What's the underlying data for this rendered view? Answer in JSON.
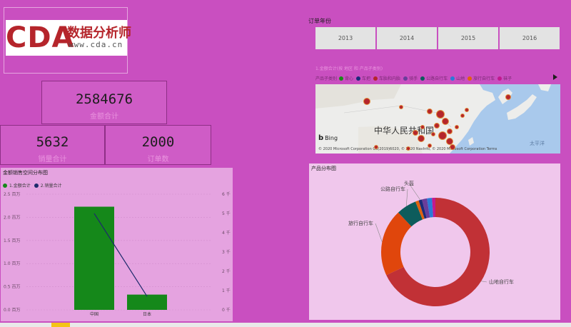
{
  "logo": {
    "brand": "CDA",
    "cn_text": "数据分析师",
    "url_text": "www.cda.cn"
  },
  "kpis": {
    "amount": {
      "value": "2584676",
      "label": "金额合计"
    },
    "quantity": {
      "value": "5632",
      "label": "销量合计"
    },
    "orders": {
      "value": "2000",
      "label": "订单数"
    }
  },
  "slicer": {
    "title": "订单年份",
    "years": [
      "2013",
      "2014",
      "2015",
      "2016"
    ]
  },
  "map": {
    "title": "1.金额合计(按 地区 和 产品子类别)",
    "legend_title": "产品子类别",
    "legend": [
      {
        "name": "背心",
        "color": "#1a8a1a"
      },
      {
        "name": "车把",
        "color": "#1c2b7a"
      },
      {
        "name": "车胎和内胎",
        "color": "#b5252b"
      },
      {
        "name": "骑手",
        "color": "#6a3d9a"
      },
      {
        "name": "公路自行车",
        "color": "#0d5c5c"
      },
      {
        "name": "山地",
        "color": "#2b7bd6"
      },
      {
        "name": "旅行自行车",
        "color": "#e0620e"
      },
      {
        "name": "袜子",
        "color": "#c2198f"
      }
    ],
    "country_label": "中华人民共和国",
    "pacific_label": "太平洋",
    "bing": "Bing",
    "copyright": "© 2020 Microsoft Corporation  GS(2019)6020, © 2020 NavInfo, © 2020 Microsoft Corporation  Terms"
  },
  "bar_panel": {
    "title": "金额销售空间分布图",
    "legend": [
      "1.金额合计",
      "2.销量合计"
    ]
  },
  "pie_panel": {
    "title": "产品分布图"
  },
  "chart_data": [
    {
      "type": "bar",
      "title": "金额销售空间分布图",
      "categories": [
        "中国",
        "日本"
      ],
      "series": [
        {
          "name": "1.金额合计",
          "kind": "bar",
          "axis": "left",
          "values": [
            2230000,
            330000
          ],
          "color": "#15881a"
        },
        {
          "name": "2.销量合计",
          "kind": "line",
          "axis": "right",
          "values": [
            5000,
            700
          ],
          "color": "#1d2a6b"
        }
      ],
      "y_left_ticks": [
        "0.0 百万",
        "0.5 百万",
        "1.0 百万",
        "1.5 百万",
        "2.0 百万",
        "2.5 百万"
      ],
      "y_left_range": [
        0,
        2500000
      ],
      "y_right_ticks": [
        "0 千",
        "1 千",
        "2 千",
        "3 千",
        "4 千",
        "5 千",
        "6 千"
      ],
      "y_right_range": [
        0,
        6000
      ]
    },
    {
      "type": "pie",
      "title": "产品分布图",
      "donut": true,
      "slices": [
        {
          "name": "山地自行车",
          "value": 0.68,
          "color": "#c13136"
        },
        {
          "name": "旅行自行车",
          "value": 0.2,
          "color": "#e0460c"
        },
        {
          "name": "公路自行车",
          "value": 0.06,
          "color": "#0d5c5c"
        },
        {
          "name": "",
          "value": 0.01,
          "color": "#e0620e"
        },
        {
          "name": "头盔",
          "value": 0.01,
          "color": "#1c2b7a"
        },
        {
          "name": "",
          "value": 0.015,
          "color": "#6a3d9a"
        },
        {
          "name": "",
          "value": 0.015,
          "color": "#2b7bd6"
        },
        {
          "name": "",
          "value": 0.01,
          "color": "#c2198f"
        }
      ]
    }
  ]
}
